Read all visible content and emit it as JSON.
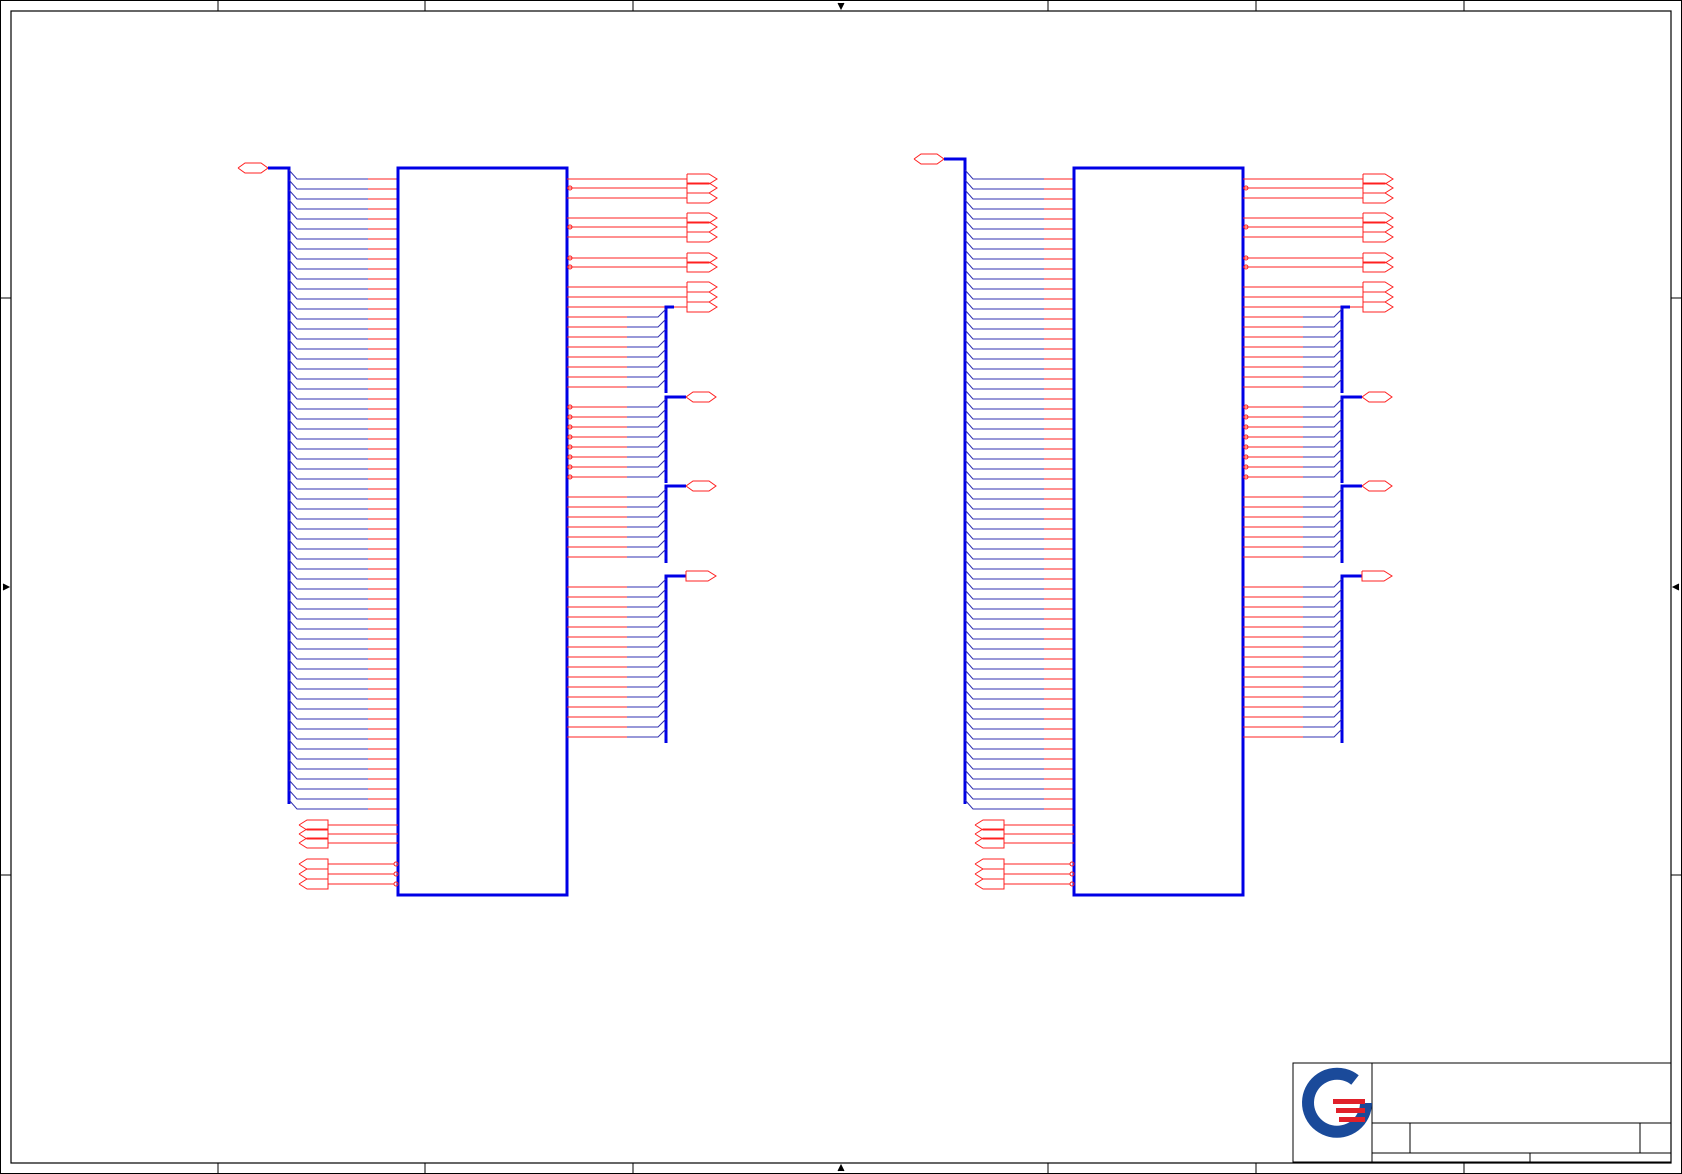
{
  "colors": {
    "background": "#ffffff",
    "frame": "#000000",
    "bus": "#0000e6",
    "part": "#0000e6",
    "net_red": "#ff2020",
    "net_blue": "#3030b0",
    "logo_blue": "#1a4a9a",
    "logo_red": "#e0202a"
  },
  "sheet": {
    "title_block": {
      "logo": "company-logo"
    }
  },
  "symbols": [
    {
      "id": "u-left",
      "left_pins": 64,
      "bottom_ports": 6
    },
    {
      "id": "u-right",
      "left_pins": 64,
      "bottom_ports": 6
    }
  ]
}
